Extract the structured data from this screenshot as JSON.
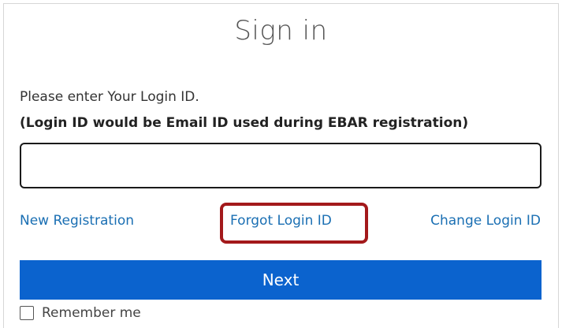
{
  "header": {
    "title": "Sign in"
  },
  "form": {
    "instruction": "Please enter Your Login ID.",
    "note": "(Login ID would be Email ID used during EBAR registration)",
    "login_id_value": "",
    "login_id_placeholder": ""
  },
  "links": {
    "new_registration": "New Registration",
    "forgot_login_id": "Forgot Login ID",
    "change_login_id": "Change Login ID"
  },
  "actions": {
    "next_label": "Next"
  },
  "remember_me": {
    "label": "Remember me",
    "checked": false
  },
  "colors": {
    "primary_button": "#0b63ce",
    "link": "#1a6fb3",
    "highlight": "#a3191b"
  }
}
